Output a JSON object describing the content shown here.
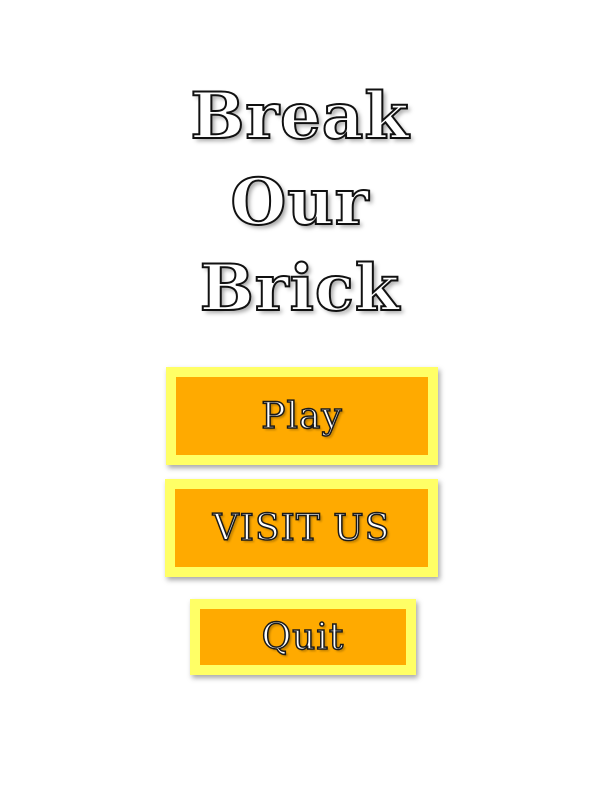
{
  "title": {
    "line1": "Break",
    "line2": "Our",
    "line3": "Brick"
  },
  "menu": {
    "play_label": "Play",
    "visit_label": "VISIT US",
    "quit_label": "Quit"
  },
  "colors": {
    "button_fill": "#ffaa00",
    "button_border": "#ffff66",
    "background": "#ffffff",
    "text_outline": "#111111"
  }
}
